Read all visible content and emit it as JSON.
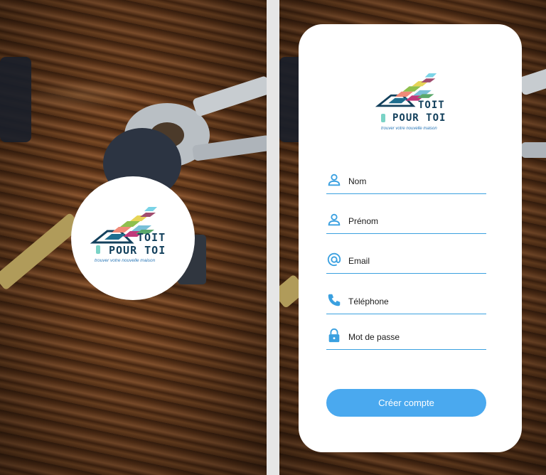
{
  "splash": {
    "logo": {
      "line1": "TOIT",
      "line2": "POUR TOI",
      "tagline": "trouver votre nouvelle maison"
    }
  },
  "signup": {
    "logo": {
      "line1": "TOIT",
      "line2": "POUR TOI",
      "tagline": "trouver votre nouvelle maison"
    },
    "fields": [
      {
        "label": "Nom",
        "icon": "person-icon"
      },
      {
        "label": "Prénom",
        "icon": "person-icon"
      },
      {
        "label": "Email",
        "icon": "at-icon"
      },
      {
        "label": "Téléphone",
        "icon": "phone-icon"
      },
      {
        "label": "Mot de passe",
        "icon": "lock-icon"
      }
    ],
    "submit_label": "Créer compte"
  },
  "colors": {
    "accent": "#4aa9ef",
    "underline": "#3aa0e0",
    "brand_dark": "#13405c"
  }
}
